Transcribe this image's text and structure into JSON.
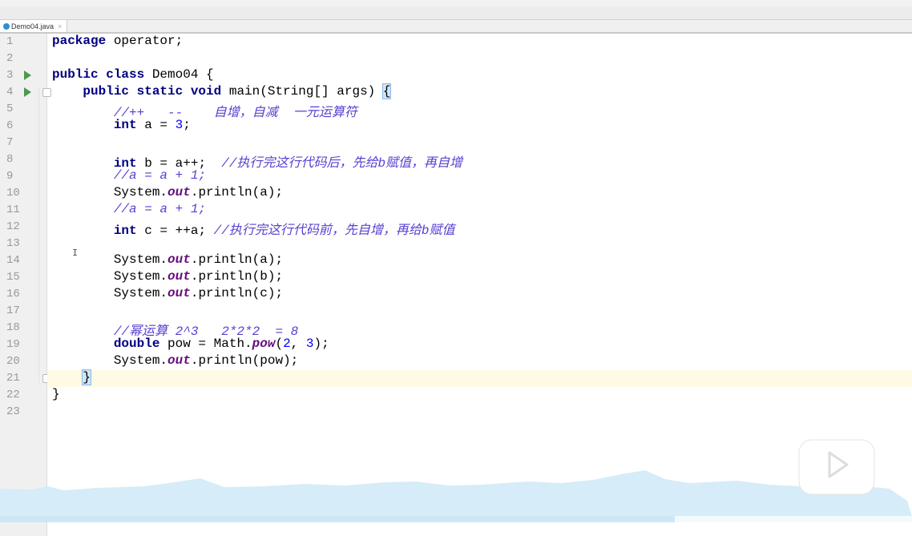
{
  "tab": {
    "filename": "Demo04.java",
    "close": "×"
  },
  "current_line": 21,
  "run_lines": [
    3,
    4
  ],
  "lines": [
    [
      [
        "kw",
        "package"
      ],
      [
        "p",
        " operator;"
      ]
    ],
    [],
    [
      [
        "kw",
        "public class"
      ],
      [
        "p",
        " Demo04 {"
      ]
    ],
    [
      [
        "p",
        "    "
      ],
      [
        "kw",
        "public static void"
      ],
      [
        "p",
        " main(String[] args) "
      ],
      [
        "br",
        "{"
      ]
    ],
    [
      [
        "p",
        "        "
      ],
      [
        "cm",
        "//++   --    自增，自减  一元运算符"
      ]
    ],
    [
      [
        "p",
        "        "
      ],
      [
        "kw",
        "int"
      ],
      [
        "p",
        " a = "
      ],
      [
        "num",
        "3"
      ],
      [
        "p",
        ";"
      ]
    ],
    [],
    [
      [
        "p",
        "        "
      ],
      [
        "kw",
        "int"
      ],
      [
        "p",
        " b = a++;  "
      ],
      [
        "cm",
        "//执行完这行代码后，先给b赋值，再自增"
      ]
    ],
    [
      [
        "p",
        "        "
      ],
      [
        "cm",
        "//a = a + 1;"
      ]
    ],
    [
      [
        "p",
        "        System."
      ],
      [
        "fld",
        "out"
      ],
      [
        "p",
        ".println(a);"
      ]
    ],
    [
      [
        "p",
        "        "
      ],
      [
        "cm",
        "//a = a + 1;"
      ]
    ],
    [
      [
        "p",
        "        "
      ],
      [
        "kw",
        "int"
      ],
      [
        "p",
        " c = ++a; "
      ],
      [
        "cm",
        "//执行完这行代码前，先自增，再给b赋值"
      ]
    ],
    [],
    [
      [
        "p",
        "        System."
      ],
      [
        "fld",
        "out"
      ],
      [
        "p",
        ".println(a);"
      ]
    ],
    [
      [
        "p",
        "        System."
      ],
      [
        "fld",
        "out"
      ],
      [
        "p",
        ".println(b);"
      ]
    ],
    [
      [
        "p",
        "        System."
      ],
      [
        "fld",
        "out"
      ],
      [
        "p",
        ".println(c);"
      ]
    ],
    [],
    [
      [
        "p",
        "        "
      ],
      [
        "cm",
        "//幂运算 2^3   2*2*2  = 8"
      ]
    ],
    [
      [
        "p",
        "        "
      ],
      [
        "kw",
        "double"
      ],
      [
        "p",
        " pow = Math."
      ],
      [
        "fld",
        "pow"
      ],
      [
        "p",
        "("
      ],
      [
        "num",
        "2"
      ],
      [
        "p",
        ", "
      ],
      [
        "num",
        "3"
      ],
      [
        "p",
        ");"
      ]
    ],
    [
      [
        "p",
        "        System."
      ],
      [
        "fld",
        "out"
      ],
      [
        "p",
        ".println(pow);"
      ]
    ],
    [
      [
        "p",
        "    "
      ],
      [
        "br",
        "}"
      ]
    ],
    [
      [
        "p",
        "}"
      ]
    ],
    []
  ],
  "video_progress_percent": 74
}
